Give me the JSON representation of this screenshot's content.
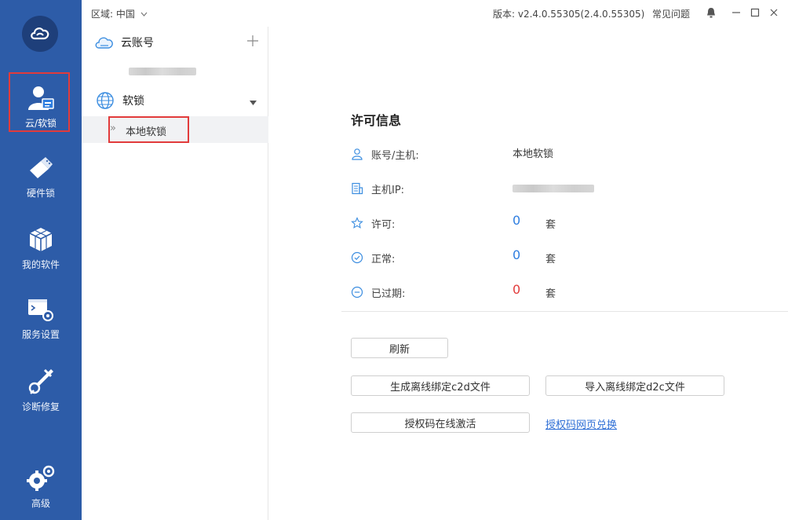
{
  "topbar": {
    "region_label": "区域: 中国",
    "region_chevron_icon": "chevron-down-icon",
    "version_text": "版本: v2.4.0.55305(2.4.0.55305)",
    "faq_label": "常见问题",
    "icons": [
      "bell-icon",
      "minimize-icon",
      "maximize-icon",
      "close-icon"
    ]
  },
  "rail": {
    "logo_icon": "cloud-logo-icon",
    "items": [
      {
        "label": "云/软锁",
        "icon": "user-card-icon",
        "active": true
      },
      {
        "label": "硬件锁",
        "icon": "usb-key-icon",
        "active": false
      },
      {
        "label": "我的软件",
        "icon": "cube-icon",
        "active": false
      },
      {
        "label": "服务设置",
        "icon": "terminal-gear-icon",
        "active": false
      },
      {
        "label": "诊断修复",
        "icon": "wrench-icon",
        "active": false
      },
      {
        "label": "高级",
        "icon": "gears-icon",
        "active": false
      }
    ],
    "accent_color": "#2d5ca8"
  },
  "tree": {
    "cloud_header": "云账号",
    "cloud_icon": "cloud-icon",
    "add_icon": "plus-icon",
    "soft_header": "软锁",
    "soft_icon": "globe-icon",
    "soft_chevron_icon": "caret-down-icon",
    "selected_item": "本地软锁",
    "selected_arrow": "»"
  },
  "license": {
    "title": "许可信息",
    "rows": [
      {
        "label": "账号/主机:",
        "value": "本地软锁",
        "icon": "user-icon"
      },
      {
        "label": "主机IP:",
        "value": "",
        "icon": "server-icon"
      },
      {
        "label": "许可:",
        "value": "0",
        "unit": "套",
        "icon": "star-icon"
      },
      {
        "label": "正常:",
        "value": "0",
        "unit": "套",
        "icon": "check-circle-icon"
      },
      {
        "label": "已过期:",
        "value": "0",
        "unit": "套",
        "icon": "minus-circle-icon"
      }
    ],
    "value_color": "#2f7ee0",
    "expired_color": "#e23b3b"
  },
  "actions": {
    "refresh": "刷新",
    "gen_c2d": "生成离线绑定c2d文件",
    "import_d2c": "导入离线绑定d2c文件",
    "activate_online": "授权码在线激活",
    "web_redeem": "授权码网页兑换"
  }
}
